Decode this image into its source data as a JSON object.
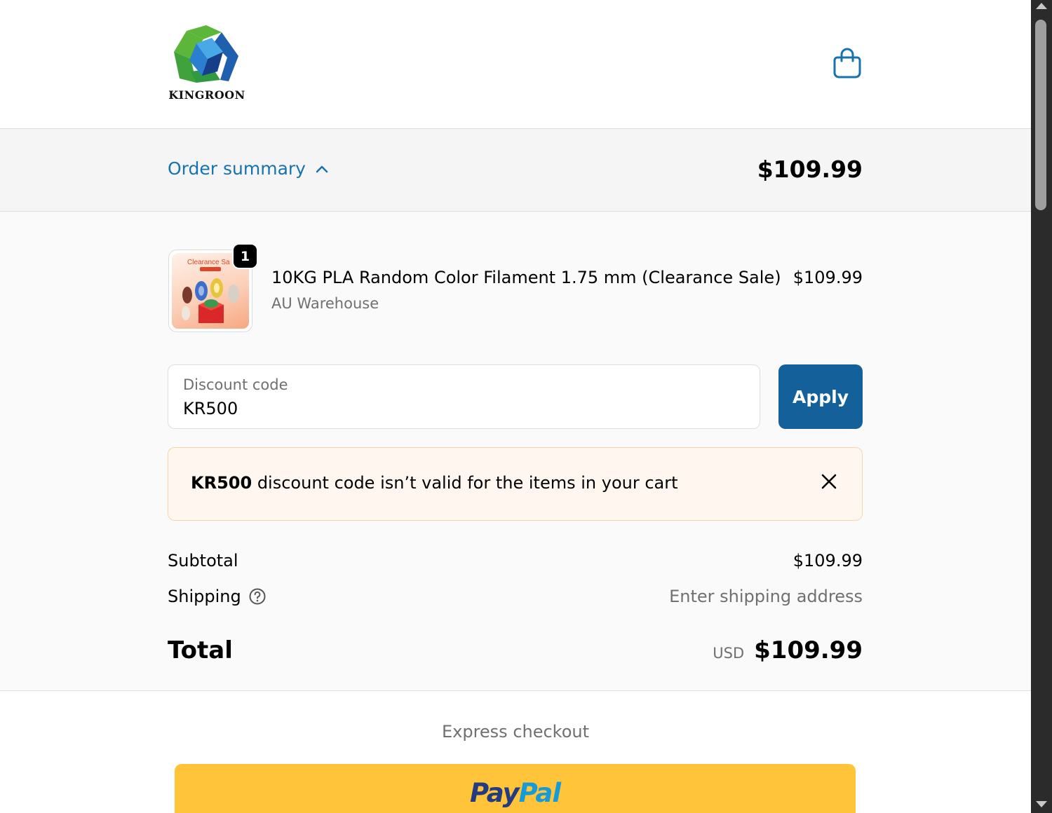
{
  "header": {
    "logo_text": "KINGROON",
    "logo_icon": "kingroon-cube-logo",
    "cart_icon": "shopping-bag-icon"
  },
  "summary": {
    "toggle_label": "Order summary",
    "toggle_icon": "chevron-up-icon",
    "total": "$109.99"
  },
  "product": {
    "quantity": "1",
    "thumbnail_label": "Clearance Sa",
    "title": "10KG PLA Random Color Filament 1.75 mm (Clearance Sale)",
    "variant": "AU Warehouse",
    "price": "$109.99"
  },
  "discount": {
    "label": "Discount code",
    "value": "KR500",
    "apply_label": "Apply"
  },
  "error": {
    "code": "KR500",
    "message": " discount code isn’t valid for the items in your cart",
    "close_icon": "close-icon"
  },
  "totals": {
    "subtotal_label": "Subtotal",
    "subtotal_value": "$109.99",
    "shipping_label": "Shipping",
    "shipping_value": "Enter shipping address",
    "help_icon": "question-circle-icon",
    "total_label": "Total",
    "currency": "USD",
    "total_value": "$109.99"
  },
  "express": {
    "label": "Express checkout",
    "paypal_part1": "Pay",
    "paypal_part2": "Pal"
  },
  "colors": {
    "accent_link": "#1773b0",
    "apply_button": "#13609b",
    "error_bg": "#fff7ef",
    "error_border": "#f7d5ab",
    "paypal_yellow": "#ffc439"
  }
}
